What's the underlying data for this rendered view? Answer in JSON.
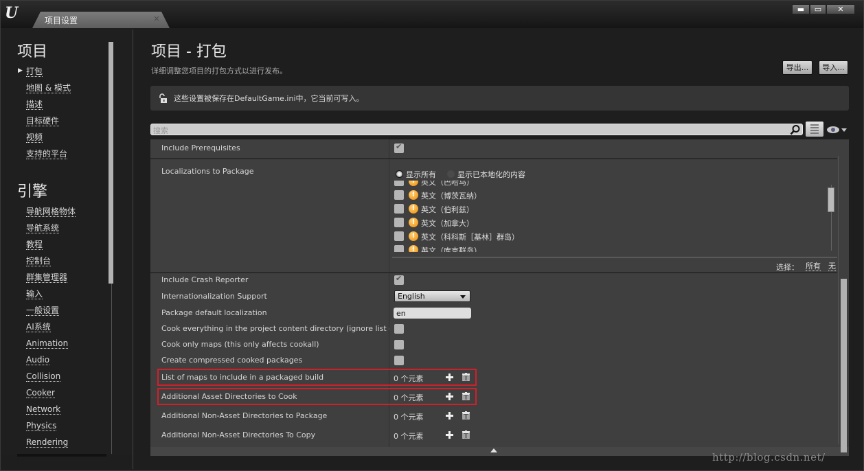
{
  "window": {
    "tab_title": "项目设置",
    "tab_close": "×",
    "controls": {
      "minimize": "▬",
      "maximize": "▭",
      "close": "✕"
    }
  },
  "sidebar": {
    "sections": [
      {
        "title": "项目",
        "items": [
          "打包",
          "地图 & 模式",
          "描述",
          "目标硬件",
          "视频",
          "支持的平台"
        ],
        "active_index": 0
      },
      {
        "title": "引擎",
        "items": [
          "导航网格物体",
          "导航系统",
          "教程",
          "控制台",
          "群集管理器",
          "输入",
          "一般设置",
          "AI系统",
          "Animation",
          "Audio",
          "Collision",
          "Cooker",
          "Network",
          "Physics",
          "Rendering"
        ]
      }
    ],
    "active_arrow": "▶"
  },
  "header": {
    "title": "项目 - 打包",
    "subtitle": "详细调整您项目的打包方式以进行发布。",
    "export_label": "导出...",
    "import_label": "导入..."
  },
  "info_bar": {
    "text": "这些设置被保存在DefaultGame.ini中，它当前可写入。"
  },
  "search": {
    "placeholder": "搜索"
  },
  "properties": {
    "include_prerequisites": {
      "label": "Include Prerequisites",
      "checked": true
    },
    "localizations": {
      "label": "Localizations to Package",
      "radio_all": "显示所有",
      "radio_localized": "显示已本地化的内容",
      "selected_radio": "显示所有",
      "items": [
        "英文（巴哈马）",
        "英文（博茨瓦纳）",
        "英文（伯利兹）",
        "英文（加拿大）",
        "英文（科科斯［基林］群岛）",
        "英文（库克群岛）"
      ],
      "select_label": "选择：",
      "select_all": "所有",
      "select_none": "无"
    },
    "include_crash_reporter": {
      "label": "Include Crash Reporter",
      "checked": true
    },
    "internationalization_support": {
      "label": "Internationalization Support",
      "value": "English"
    },
    "package_default_localization": {
      "label": "Package default localization",
      "value": "en"
    },
    "cook_everything": {
      "label": "Cook everything in the project content directory (ignore list of maps below)",
      "checked": false
    },
    "cook_only_maps": {
      "label": "Cook only maps (this only affects cookall)",
      "checked": false
    },
    "create_compressed": {
      "label": "Create compressed cooked packages",
      "checked": false
    },
    "arrays": [
      {
        "label": "List of maps to include in a packaged build",
        "count": "0 个元素",
        "highlighted": true
      },
      {
        "label": "Additional Asset Directories to Cook",
        "count": "0 个元素",
        "highlighted": true
      },
      {
        "label": "Additional Non-Asset Directories to Package",
        "count": "0 个元素",
        "highlighted": false
      },
      {
        "label": "Additional Non-Asset Directories To Copy",
        "count": "0 个元素",
        "highlighted": false
      }
    ]
  },
  "colors": {
    "highlight": "#d0202a",
    "warning": "#f08a00"
  },
  "watermark": "http://blog.csdn.net/"
}
